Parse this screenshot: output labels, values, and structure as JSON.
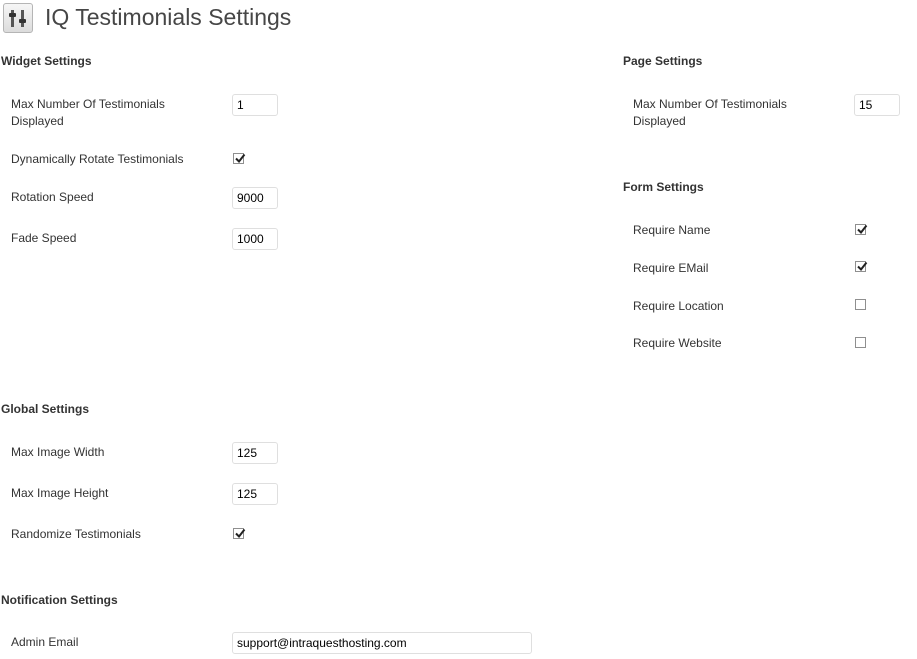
{
  "page": {
    "title": "IQ Testimonials Settings",
    "icon": "settings-sliders-icon"
  },
  "widget_settings": {
    "title": "Widget Settings",
    "max_number_label": "Max Number Of Testimonials Displayed",
    "max_number_value": "1",
    "rotate_label": "Dynamically Rotate Testimonials",
    "rotate_checked": true,
    "rotation_speed_label": "Rotation Speed",
    "rotation_speed_value": "9000",
    "fade_speed_label": "Fade Speed",
    "fade_speed_value": "1000"
  },
  "page_settings": {
    "title": "Page Settings",
    "max_number_label": "Max Number Of Testimonials Displayed",
    "max_number_value": "15"
  },
  "form_settings": {
    "title": "Form Settings",
    "require_name_label": "Require Name",
    "require_name_checked": true,
    "require_email_label": "Require EMail",
    "require_email_checked": true,
    "require_location_label": "Require Location",
    "require_location_checked": false,
    "require_website_label": "Require Website",
    "require_website_checked": false
  },
  "global_settings": {
    "title": "Global Settings",
    "max_width_label": "Max Image Width",
    "max_width_value": "125",
    "max_height_label": "Max Image Height",
    "max_height_value": "125",
    "randomize_label": "Randomize Testimonials",
    "randomize_checked": true
  },
  "notification_settings": {
    "title": "Notification Settings",
    "admin_email_label": "Admin Email",
    "admin_email_value": "support@intraquesthosting.com"
  }
}
